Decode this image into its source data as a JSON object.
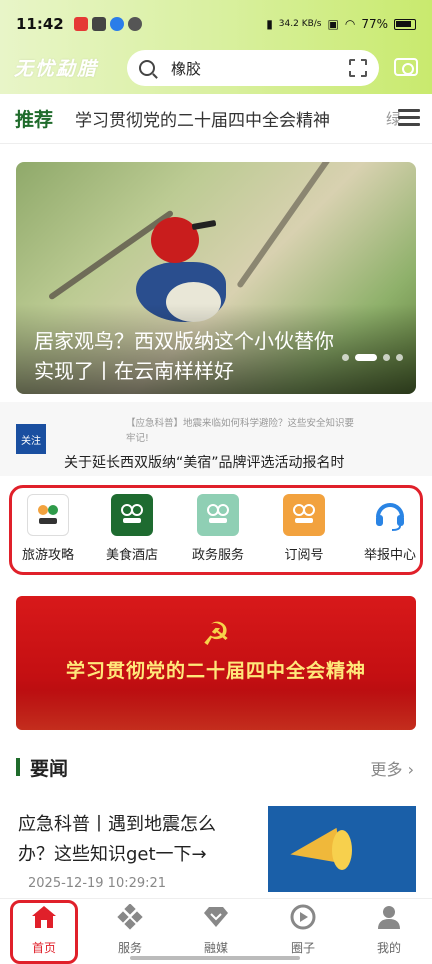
{
  "status_bar": {
    "time": "11:42",
    "network_speed": "34.2 KB/s",
    "battery": "77%"
  },
  "header": {
    "logo": "无忧勐腊",
    "search_value": "橡胶"
  },
  "tabs": {
    "recommend": "推荐",
    "headline": "学习贯彻党的二十届四中全会精神",
    "overflow": "绿"
  },
  "banner": {
    "title": "居家观鸟？西双版纳这个小伙替你实现了丨在云南样样好",
    "page_count": 4,
    "active_page": 2
  },
  "ticker": {
    "badge": "关注",
    "previous": "【应急科普】地震来临如何科学避险？这些安全知识要牢记!",
    "current": "关于延长西双版纳“美宿”品牌评选活动报名时"
  },
  "services": [
    {
      "label": "旅游攻略",
      "icon": "travel-icon",
      "color": "#ffffff"
    },
    {
      "label": "美食酒店",
      "icon": "food-icon",
      "color": "#1e6b30"
    },
    {
      "label": "政务服务",
      "icon": "gov-icon",
      "color": "#8fcfb4"
    },
    {
      "label": "订阅号",
      "icon": "subscribe-icon",
      "color": "#f2a23e"
    },
    {
      "label": "举报中心",
      "icon": "headset-icon",
      "color": "#2a84e4"
    }
  ],
  "red_banner": {
    "title": "学习贯彻党的二十届四中全会精神"
  },
  "news": {
    "section_title": "要闻",
    "more": "更多",
    "article": {
      "title": "应急科普丨遇到地震怎么办？这些知识get一下→",
      "time": "2025-12-19 10:29:21"
    }
  },
  "bottom_nav": [
    {
      "label": "首页",
      "icon": "home-icon",
      "active": true
    },
    {
      "label": "服务",
      "icon": "service-icon",
      "active": false
    },
    {
      "label": "融媒",
      "icon": "media-icon",
      "active": false
    },
    {
      "label": "圈子",
      "icon": "circle-icon",
      "active": false
    },
    {
      "label": "我的",
      "icon": "profile-icon",
      "active": false
    }
  ],
  "colors": {
    "brand_green": "#1f6b2b",
    "highlight_red": "#e0202a"
  }
}
